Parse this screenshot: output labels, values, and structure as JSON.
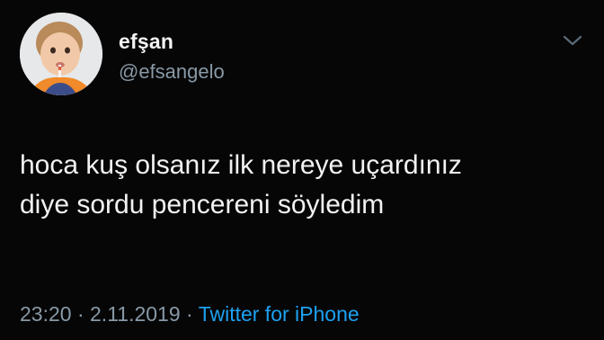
{
  "user": {
    "display_name": "efşan",
    "handle": "@efsangelo",
    "avatar_icon": "profile-photo"
  },
  "menu": {
    "icon": "chevron-down-icon"
  },
  "tweet": {
    "lines": [
      "hoca kuş olsanız ilk nereye uçardınız",
      "diye sordu pencereni söyledim"
    ],
    "time": "23:20",
    "separator1": "·",
    "date": "2.11.2019",
    "separator2": "·",
    "source": "Twitter for iPhone"
  },
  "colors": {
    "background": "#060606",
    "primary_text": "#f2f2f2",
    "secondary_text": "#8899a6",
    "link": "#1da1f2"
  }
}
